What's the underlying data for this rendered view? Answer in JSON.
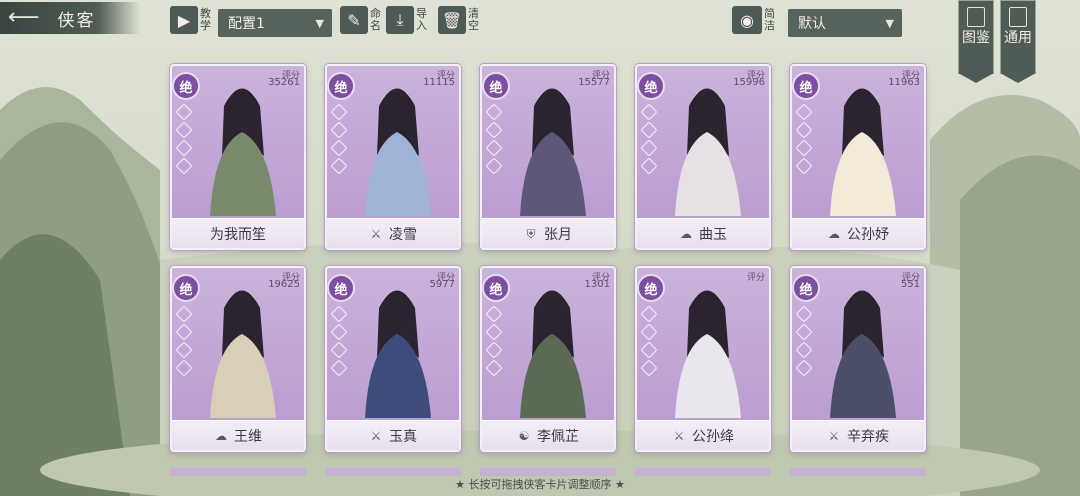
{
  "header": {
    "back_icon": "back-arrow-icon",
    "title": "侠客",
    "teach_label": "教学",
    "preset_value": "配置1",
    "rename_label": "命名",
    "import_label": "导入",
    "clear_label": "清空",
    "simplify_label": "简洁",
    "sort_value": "默认",
    "tab_codex": "图鉴",
    "tab_general": "通用"
  },
  "cards": [
    {
      "rank": "绝",
      "score_label": "评分",
      "score": "35261",
      "name": "为我而笙",
      "icon": ""
    },
    {
      "rank": "绝",
      "score_label": "评分",
      "score": "11115",
      "name": "凌雪",
      "icon": "sword-icon"
    },
    {
      "rank": "绝",
      "score_label": "评分",
      "score": "15577",
      "name": "张月",
      "icon": "shield-icon"
    },
    {
      "rank": "绝",
      "score_label": "评分",
      "score": "15996",
      "name": "曲玉",
      "icon": "cloud-icon"
    },
    {
      "rank": "绝",
      "score_label": "评分",
      "score": "11963",
      "name": "公孙妤",
      "icon": "cloud-icon"
    },
    {
      "rank": "绝",
      "score_label": "评分",
      "score": "19625",
      "name": "王维",
      "icon": "cloud-icon"
    },
    {
      "rank": "绝",
      "score_label": "评分",
      "score": "5977",
      "name": "玉真",
      "icon": "sword-icon"
    },
    {
      "rank": "绝",
      "score_label": "评分",
      "score": "1301",
      "name": "李佩芷",
      "icon": "yinyang-icon"
    },
    {
      "rank": "绝",
      "score_label": "评分",
      "score": "",
      "name": "公孙绛",
      "icon": "sword-icon"
    },
    {
      "rank": "绝",
      "score_label": "评分",
      "score": "551",
      "name": "辛弃疾",
      "icon": "sword-icon"
    }
  ],
  "hint": "★ 长按可拖拽侠客卡片调整顺序 ★",
  "colors": {
    "accent": "#7c4fa1",
    "bar": "#4f5c56",
    "card": "#c3a8d8"
  }
}
